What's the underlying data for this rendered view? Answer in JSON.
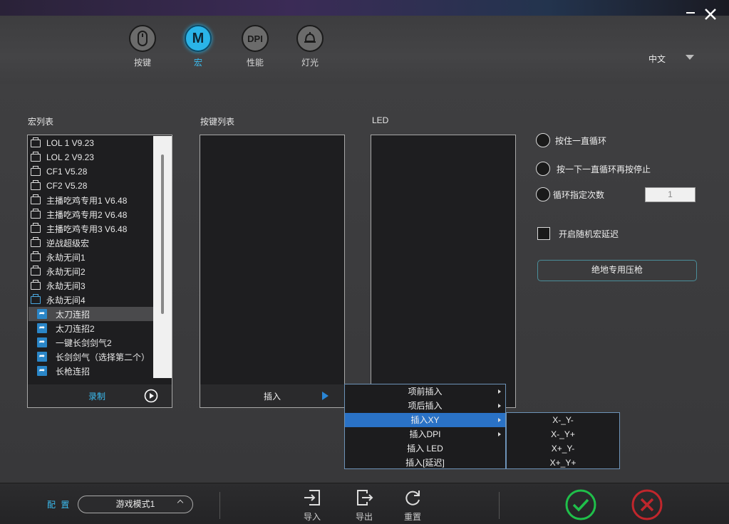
{
  "nav": {
    "items": [
      {
        "label": "按键",
        "glyph": ""
      },
      {
        "label": "宏",
        "glyph": "M"
      },
      {
        "label": "性能",
        "glyph": "DPI"
      },
      {
        "label": "灯光",
        "glyph": ""
      }
    ]
  },
  "language": "中文",
  "sections": {
    "macro_list": "宏列表",
    "key_list": "按键列表",
    "led": "LED"
  },
  "macros": {
    "items": [
      "LOL 1  V9.23",
      "LOL 2  V9.23",
      "CF1  V5.28",
      "CF2  V5.28",
      "主播吃鸡专用1 V6.48",
      "主播吃鸡专用2 V6.48",
      "主播吃鸡专用3 V6.48",
      "逆战超级宏",
      "永劫无间1",
      "永劫无间2",
      "永劫无间3",
      "永劫无间4",
      "太刀连招",
      "太刀连招2",
      "一键长剑剑气2",
      "长剑剑气（选择第二个）",
      "长枪连招"
    ],
    "record_label": "录制"
  },
  "key_list": {
    "insert_label": "插入"
  },
  "options": {
    "loop_hold": "按住一直循环",
    "loop_toggle": "按一下一直循环再按停止",
    "loop_count": "循环指定次数",
    "loop_count_value": "1",
    "random_delay": "开启随机宏延迟",
    "pubg_button": "绝地专用压枪"
  },
  "insert_menu": {
    "items": [
      "项前插入",
      "项后插入",
      "插入XY",
      "插入DPI",
      "插入 LED",
      "插入[延迟]"
    ]
  },
  "xy_menu": {
    "items": [
      "X-_Y-",
      "X-_Y+",
      "X+_Y-",
      "X+_Y+"
    ]
  },
  "footer": {
    "config_label": "配 置",
    "profile": "游戏模式1",
    "import": "导入",
    "export": "导出",
    "reset": "重置"
  },
  "colors": {
    "accent": "#2ab4e8",
    "confirm": "#1fbf4a",
    "cancel": "#c0262c",
    "menu_highlight": "#2a72c6"
  }
}
